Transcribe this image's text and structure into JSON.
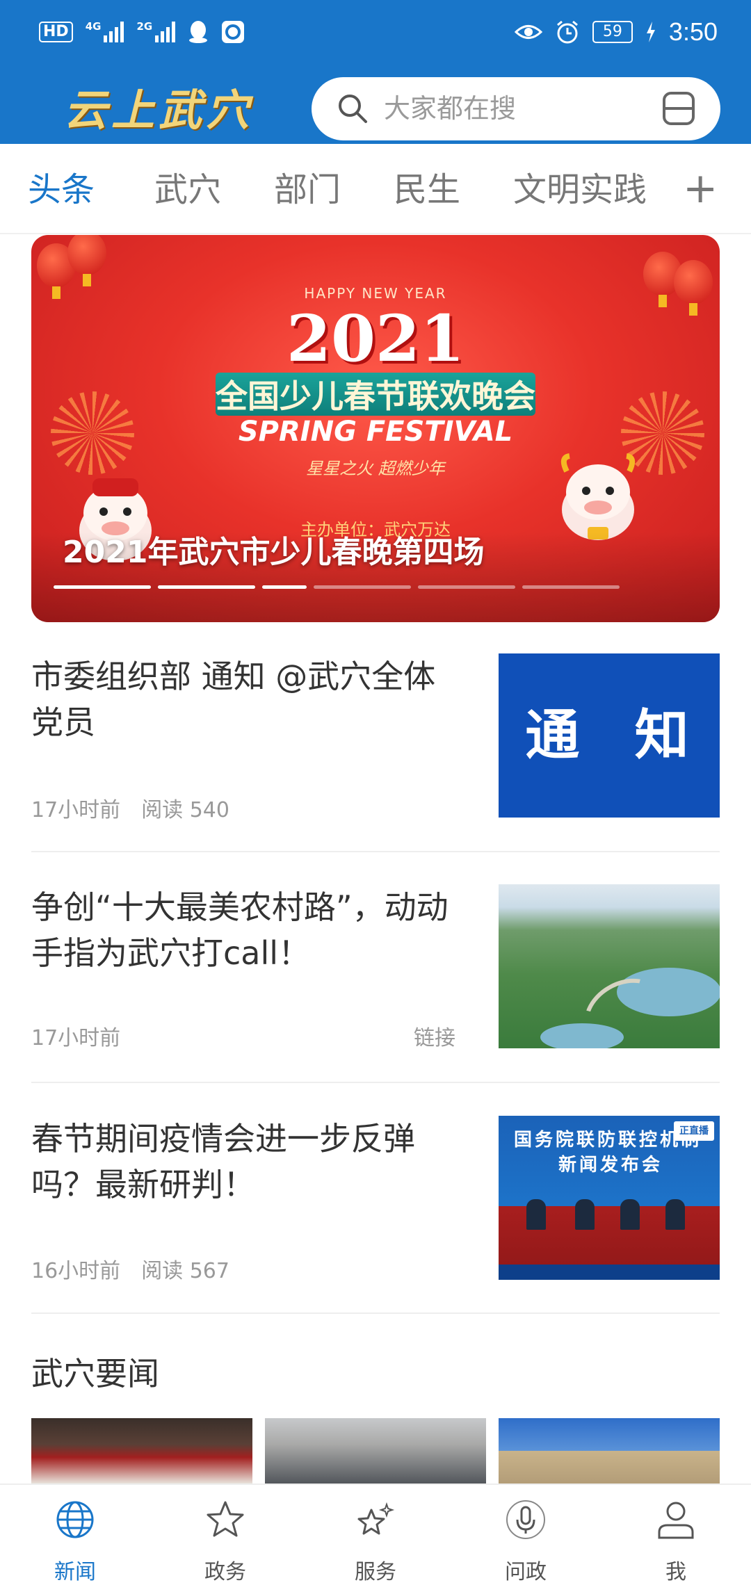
{
  "status_bar": {
    "hd": "HD",
    "sim1": "4G",
    "sim2": "2G",
    "battery": "59",
    "time": "3:50",
    "icons": [
      "hd-icon",
      "signal-4g-icon",
      "signal-2g-icon",
      "qq-icon",
      "app-icon",
      "eye-icon",
      "alarm-icon",
      "battery-icon",
      "charging-icon"
    ]
  },
  "header": {
    "brand": "云上武穴",
    "search_placeholder": "大家都在搜",
    "accent_color": "#1976c9"
  },
  "tabs": {
    "items": [
      "头条",
      "武穴",
      "部门",
      "民生",
      "文明实践"
    ],
    "active": "头条",
    "add_label": "+"
  },
  "banner": {
    "caption": "2021年武穴市少儿春晚第四场",
    "art": {
      "greeting": "HAPPY NEW YEAR",
      "year": "2021",
      "title": "全国少儿春节联欢晚会",
      "title_en": "SPRING FESTIVAL",
      "slogan": "星星之火  超燃少年",
      "organizer": "主办单位：武穴万达"
    },
    "pages": 6,
    "active_page": 3
  },
  "news": [
    {
      "title": "市委组织部 通知 @武穴全体党员",
      "time": "17小时前",
      "reads": "阅读 540",
      "thumb_text": "通 知"
    },
    {
      "title": "争创“十大最美农村路”，动动手指为武穴打call！",
      "time": "17小时前",
      "link": "链接"
    },
    {
      "title": "春节期间疫情会进一步反弹吗？最新研判！",
      "time": "16小时前",
      "reads": "阅读 567",
      "thumb_text1": "国务院联防联控机制",
      "thumb_text2": "新闻发布会",
      "thumb_tag": "正直播"
    }
  ],
  "section": {
    "title": "武穴要闻"
  },
  "bottom_nav": {
    "items": [
      {
        "label": "新闻",
        "icon": "globe-icon",
        "active": true
      },
      {
        "label": "政务",
        "icon": "star-icon",
        "active": false
      },
      {
        "label": "服务",
        "icon": "sparkle-star-icon",
        "active": false
      },
      {
        "label": "问政",
        "icon": "microphone-icon",
        "active": false
      },
      {
        "label": "我",
        "icon": "user-icon",
        "active": false
      }
    ]
  }
}
